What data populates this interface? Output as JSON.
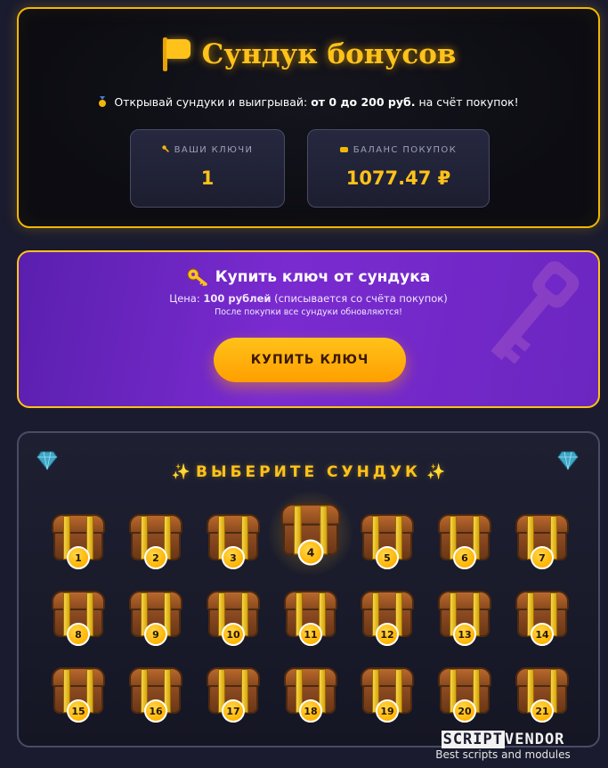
{
  "header": {
    "title": "Сундук бонусов",
    "subtitle_prefix": "Открывай сундуки и выигрывай:",
    "subtitle_prize": "от 0 до 200 руб.",
    "subtitle_suffix": "на счёт покупок!"
  },
  "stats": {
    "keys_label": "ВАШИ КЛЮЧИ",
    "keys_value": "1",
    "balance_label": "БАЛАНС ПОКУПОК",
    "balance_value": "1077.47 ₽"
  },
  "buy": {
    "title": "Купить ключ от сундука",
    "price_prefix": "Цена:",
    "price_amount": "100 рублей",
    "price_suffix": "(списывается со счёта покупок)",
    "note": "После покупки все сундуки обновляются!",
    "button_label": "КУПИТЬ КЛЮЧ"
  },
  "chests": {
    "heading": "ВЫБЕРИТЕ СУНДУК",
    "selected": 4,
    "items": [
      "1",
      "2",
      "3",
      "4",
      "5",
      "6",
      "7",
      "8",
      "9",
      "10",
      "11",
      "12",
      "13",
      "14",
      "15",
      "16",
      "17",
      "18",
      "19",
      "20",
      "21"
    ]
  },
  "watermark": {
    "brand_inverted": "SCRIPT",
    "brand_plain": "VENDOR",
    "tagline": "Best scripts and modules"
  },
  "colors": {
    "accent": "#ffc21a",
    "background": "#1a1b2e",
    "buy_panel": "#7a2bd0"
  },
  "icons": {
    "title": "flag-icon",
    "subtitle": "medal-icon",
    "keys": "key-icon",
    "balance": "card-icon",
    "buy": "key-icon",
    "corners": "diamond-icon",
    "heading": "sparkle-icon"
  }
}
